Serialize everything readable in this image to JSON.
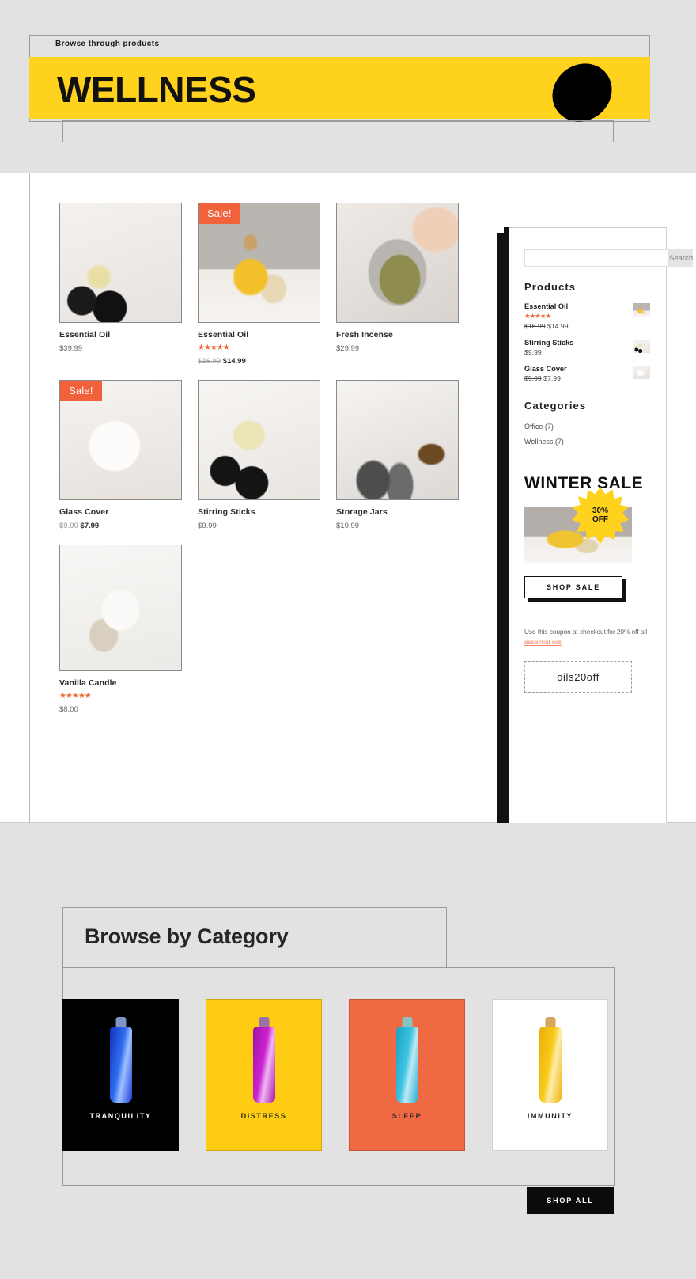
{
  "header": {
    "kicker": "Browse through products",
    "title": "WELLNESS"
  },
  "products": [
    {
      "name": "Essential Oil",
      "price": "$39.99",
      "sale": false,
      "badge": "",
      "rating": 0,
      "old_price": "",
      "new_price": ""
    },
    {
      "name": "Essential Oil",
      "price": "",
      "sale": true,
      "badge": "Sale!",
      "rating": 5,
      "old_price": "$16.99",
      "new_price": "$14.99"
    },
    {
      "name": "Fresh Incense",
      "price": "$29.99",
      "sale": false,
      "badge": "",
      "rating": 0,
      "old_price": "",
      "new_price": ""
    },
    {
      "name": "Glass Cover",
      "price": "",
      "sale": true,
      "badge": "Sale!",
      "rating": 0,
      "old_price": "$9.99",
      "new_price": "$7.99"
    },
    {
      "name": "Stirring Sticks",
      "price": "$9.99",
      "sale": false,
      "badge": "",
      "rating": 0,
      "old_price": "",
      "new_price": ""
    },
    {
      "name": "Storage Jars",
      "price": "$19.99",
      "sale": false,
      "badge": "",
      "rating": 0,
      "old_price": "",
      "new_price": ""
    },
    {
      "name": "Vanilla Candle",
      "price": "$8.00",
      "sale": false,
      "badge": "",
      "rating": 5,
      "old_price": "",
      "new_price": ""
    }
  ],
  "sidebar": {
    "search": {
      "value": "",
      "placeholder": "",
      "button_label": "Search"
    },
    "products_heading": "Products",
    "products": [
      {
        "name": "Essential Oil",
        "rating": 5,
        "old_price": "$16.99",
        "new_price": "$14.99"
      },
      {
        "name": "Stirring Sticks",
        "rating": 0,
        "old_price": "",
        "new_price": "$9.99"
      },
      {
        "name": "Glass Cover",
        "rating": 0,
        "old_price": "$9.99",
        "new_price": "$7.99"
      }
    ],
    "categories_heading": "Categories",
    "categories": [
      {
        "label": "Office (7)"
      },
      {
        "label": "Wellness (7)"
      }
    ],
    "promo": {
      "title": "WINTER SALE",
      "badge_line1": "30%",
      "badge_line2": "OFF",
      "button_label": "SHOP SALE"
    },
    "coupon": {
      "text_before": "Use this coupon at checkout for 20% off all ",
      "link": "essential oils",
      "code": "oils20off"
    }
  },
  "browse": {
    "title": "Browse by Category",
    "shop_all_label": "SHOP ALL",
    "tiles": [
      {
        "label": "TRANQUILITY",
        "bg": "#000000",
        "text_color": "#ffffff",
        "bottle": "#1b3fd8",
        "cap": "#7f94c4"
      },
      {
        "label": "DISTRESS",
        "bg": "#ffcc14",
        "text_color": "#2b2b2b",
        "bottle": "#bd1bc0",
        "cap": "#9b6fa8"
      },
      {
        "label": "SLEEP",
        "bg": "#ef6a42",
        "text_color": "#2b2b2b",
        "bottle": "#2ab6d9",
        "cap": "#89c5c0"
      },
      {
        "label": "IMMUNITY",
        "bg": "#ffffff",
        "text_color": "#2b2b2b",
        "bottle": "#f4bc0e",
        "cap": "#d6a85d"
      }
    ]
  },
  "colors": {
    "accent_yellow": "#ffd21e",
    "sale_orange": "#f1613a",
    "star_orange": "#f0642f",
    "page_bg": "#e2e2e2",
    "black": "#111111"
  }
}
